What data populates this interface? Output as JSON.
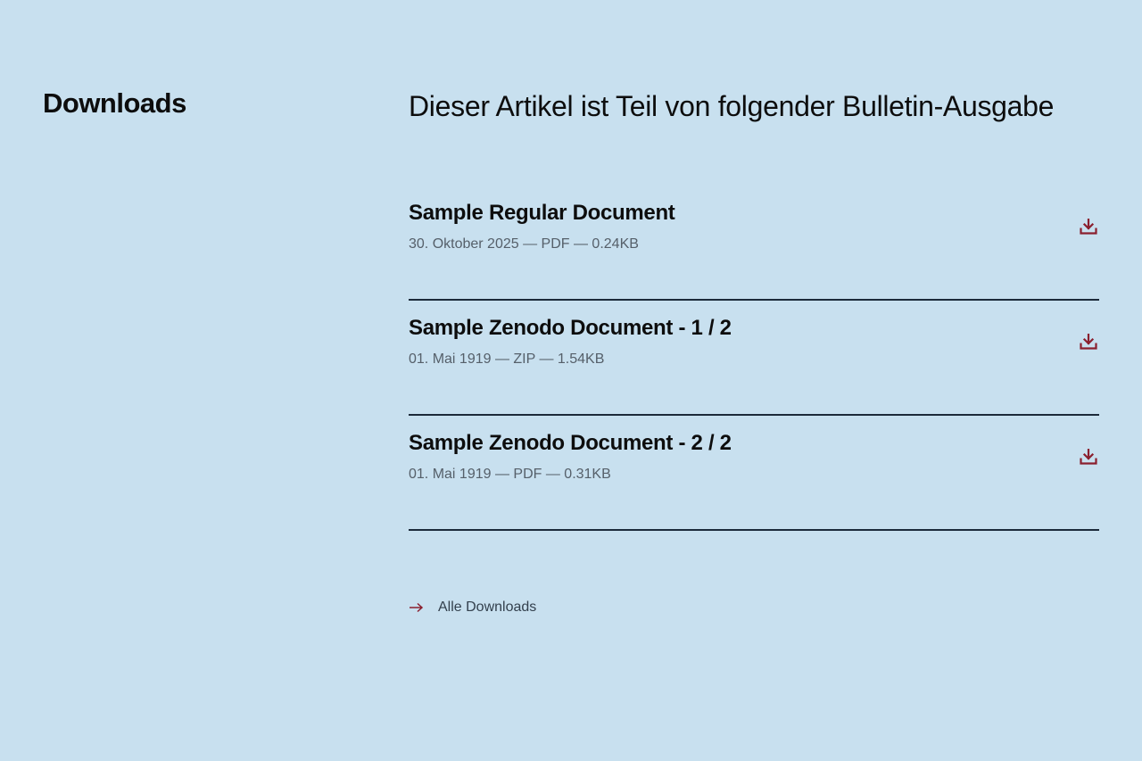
{
  "sidebar": {
    "title": "Downloads"
  },
  "main": {
    "heading": "Dieser Artikel ist Teil von folgender Bulletin-Ausgabe",
    "documents": [
      {
        "title": "Sample Regular Document",
        "meta": "30. Oktober 2025 — PDF — 0.24KB"
      },
      {
        "title": "Sample Zenodo Document - 1 / 2",
        "meta": "01. Mai 1919 — ZIP — 1.54KB"
      },
      {
        "title": "Sample Zenodo Document - 2 / 2",
        "meta": "01. Mai 1919 — PDF — 0.31KB"
      }
    ],
    "all_downloads_label": "Alle Downloads"
  },
  "colors": {
    "background": "#c8e0ef",
    "accent": "#8a1f2e",
    "divider": "#1c2a3a"
  },
  "icons": {
    "download": "download-icon",
    "arrow": "arrow-right-icon"
  }
}
